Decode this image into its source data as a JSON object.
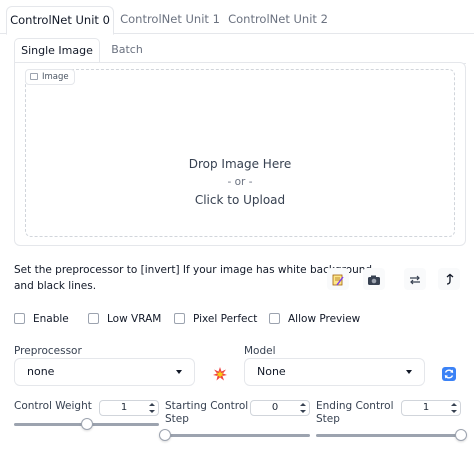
{
  "unit_tabs": [
    "ControlNet Unit 0",
    "ControlNet Unit 1",
    "ControlNet Unit 2"
  ],
  "image_tabs": [
    "Single Image",
    "Batch"
  ],
  "upload": {
    "label": "Image",
    "drop_text": "Drop Image Here",
    "or_text": "- or -",
    "click_text": "Click to Upload"
  },
  "hint_line1": "Set the preprocessor to [invert] If your image has white background",
  "hint_line2": "and black lines.",
  "tool_icons": [
    "notepad-icon",
    "camera-icon",
    "swap-icon",
    "up-arrow-icon"
  ],
  "checkboxes": [
    "Enable",
    "Low VRAM",
    "Pixel Perfect",
    "Allow Preview"
  ],
  "preprocessor": {
    "label": "Preprocessor",
    "value": "none"
  },
  "model": {
    "label": "Model",
    "value": "None"
  },
  "sliders": [
    {
      "label_line1": "Control Weight",
      "label_line2": "",
      "value": "1",
      "fraction": 0.5
    },
    {
      "label_line1": "Starting Control",
      "label_line2": "Step",
      "value": "0",
      "fraction": 0.0
    },
    {
      "label_line1": "Ending Control",
      "label_line2": "Step",
      "value": "1",
      "fraction": 1.0
    }
  ]
}
